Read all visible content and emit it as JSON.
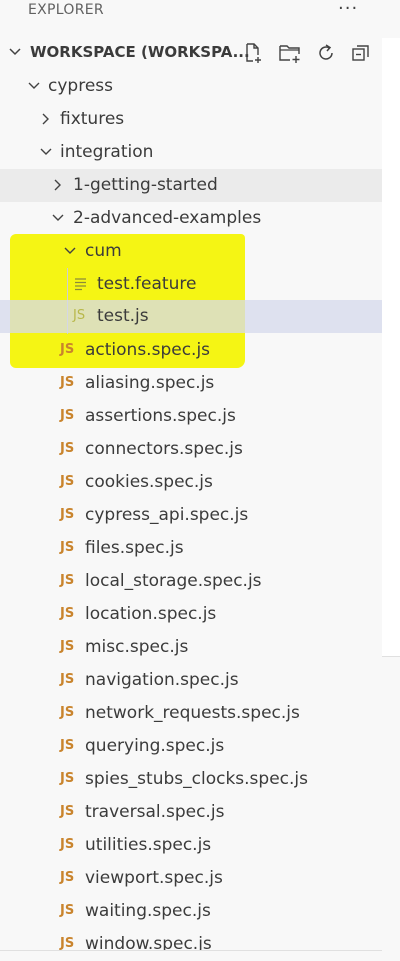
{
  "panel": {
    "title": "EXPLORER",
    "more": "···"
  },
  "workspace": {
    "title": "WORKSPACE (WORKSPA..."
  },
  "tree": [
    {
      "label": "cypress",
      "kind": "folder",
      "expanded": true
    },
    {
      "label": "fixtures",
      "kind": "folder",
      "expanded": false
    },
    {
      "label": "integration",
      "kind": "folder",
      "expanded": true
    },
    {
      "label": "1-getting-started",
      "kind": "folder",
      "expanded": false
    },
    {
      "label": "2-advanced-examples",
      "kind": "folder",
      "expanded": true
    },
    {
      "label": "cum",
      "kind": "folder",
      "expanded": true
    },
    {
      "label": "test.feature",
      "kind": "feature"
    },
    {
      "label": "test.js",
      "kind": "js",
      "icon": "JS"
    },
    {
      "label": "actions.spec.js",
      "kind": "js",
      "icon": "JS"
    },
    {
      "label": "aliasing.spec.js",
      "kind": "js",
      "icon": "JS"
    },
    {
      "label": "assertions.spec.js",
      "kind": "js",
      "icon": "JS"
    },
    {
      "label": "connectors.spec.js",
      "kind": "js",
      "icon": "JS"
    },
    {
      "label": "cookies.spec.js",
      "kind": "js",
      "icon": "JS"
    },
    {
      "label": "cypress_api.spec.js",
      "kind": "js",
      "icon": "JS"
    },
    {
      "label": "files.spec.js",
      "kind": "js",
      "icon": "JS"
    },
    {
      "label": "local_storage.spec.js",
      "kind": "js",
      "icon": "JS"
    },
    {
      "label": "location.spec.js",
      "kind": "js",
      "icon": "JS"
    },
    {
      "label": "misc.spec.js",
      "kind": "js",
      "icon": "JS"
    },
    {
      "label": "navigation.spec.js",
      "kind": "js",
      "icon": "JS"
    },
    {
      "label": "network_requests.spec.js",
      "kind": "js",
      "icon": "JS"
    },
    {
      "label": "querying.spec.js",
      "kind": "js",
      "icon": "JS"
    },
    {
      "label": "spies_stubs_clocks.spec.js",
      "kind": "js",
      "icon": "JS"
    },
    {
      "label": "traversal.spec.js",
      "kind": "js",
      "icon": "JS"
    },
    {
      "label": "utilities.spec.js",
      "kind": "js",
      "icon": "JS"
    },
    {
      "label": "viewport.spec.js",
      "kind": "js",
      "icon": "JS"
    },
    {
      "label": "waiting.spec.js",
      "kind": "js",
      "icon": "JS"
    },
    {
      "label": "window.spec.js",
      "kind": "js",
      "icon": "JS"
    }
  ],
  "colors": {
    "highlight": "#f4f400",
    "js_icon": "#c9842d",
    "selected_row": "#e4e6f1"
  }
}
